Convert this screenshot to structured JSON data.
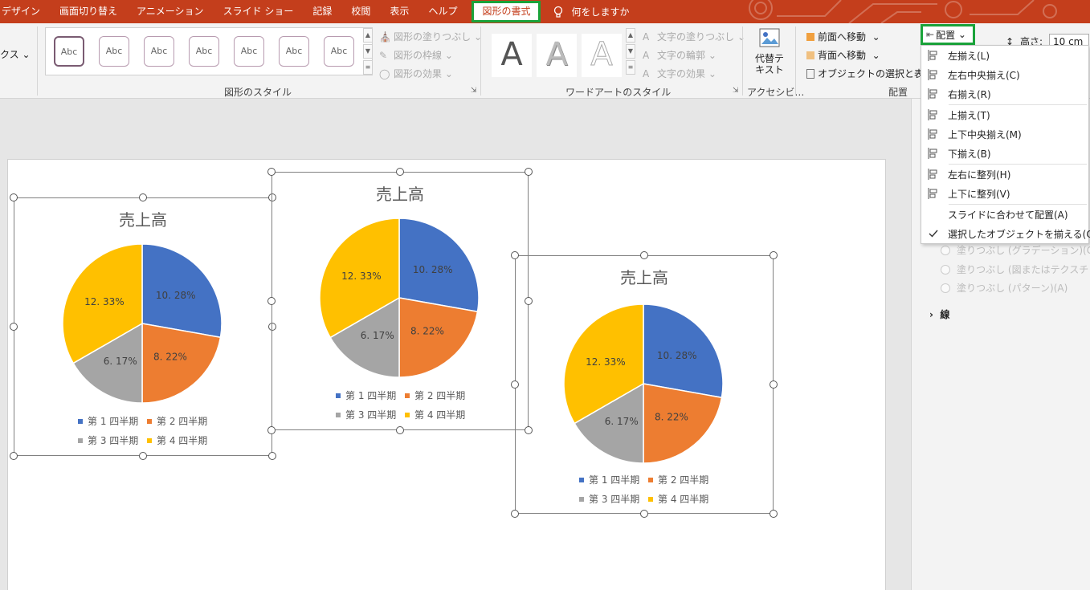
{
  "tabs": [
    "デザイン",
    "画面切り替え",
    "アニメーション",
    "スライド ショー",
    "記録",
    "校閲",
    "表示",
    "ヘルプ"
  ],
  "active_tab": "図形の書式",
  "tell_me": "何をしますか",
  "ribbon": {
    "left_cut": "クス",
    "shape_styles": {
      "abc_label": "Abc",
      "fill": "図形の塗りつぶし",
      "outline": "図形の枠線",
      "effects": "図形の効果",
      "group_label": "図形のスタイル"
    },
    "wordart": {
      "letter": "A",
      "text_fill": "文字の塗りつぶし",
      "text_outline": "文字の輪郭",
      "text_effects": "文字の効果",
      "group_label": "ワードアートのスタイル"
    },
    "alt_text": "代替テキスト",
    "alt_text_line1": "代替テ",
    "alt_text_line2": "キスト",
    "accessibility_label": "アクセシビ…",
    "arrange": {
      "bring_forward": "前面へ移動",
      "send_backward": "背面へ移動",
      "selection_pane": "オブジェクトの選択と表示",
      "group_label": "配置"
    },
    "align_button": "配置",
    "height_label": "高さ:",
    "height_value": "10 cm"
  },
  "align_menu": [
    {
      "label": "左揃え(L)",
      "sep_before": false
    },
    {
      "label": "左右中央揃え(C)",
      "sep_before": false
    },
    {
      "label": "右揃え(R)",
      "sep_before": false
    },
    {
      "label": "上揃え(T)",
      "sep_before": true
    },
    {
      "label": "上下中央揃え(M)",
      "sep_before": false
    },
    {
      "label": "下揃え(B)",
      "sep_before": false
    },
    {
      "label": "左右に整列(H)",
      "sep_before": true
    },
    {
      "label": "上下に整列(V)",
      "sep_before": false
    },
    {
      "label": "スライドに合わせて配置(A)",
      "sep_before": true
    },
    {
      "label": "選択したオブジェクトを揃える(O)",
      "sep_before": false,
      "checked": true
    }
  ],
  "right_pane": {
    "fill_gradient": "塗りつぶし (グラデーション)(G)",
    "fill_picture": "塗りつぶし (図またはテクスチャ)(P)",
    "fill_pattern": "塗りつぶし (パターン)(A)",
    "line_section": "線"
  },
  "colors": {
    "tab_bar": "#c43e1c",
    "highlight": "#1aa33a",
    "q1": "#4472c4",
    "q2": "#ed7d31",
    "q3": "#a5a5a5",
    "q4": "#ffc000"
  },
  "chart_data": [
    {
      "type": "pie",
      "title": "売上高",
      "categories": [
        "第 1 四半期",
        "第 2 四半期",
        "第 3 四半期",
        "第 4 四半期"
      ],
      "values": [
        10.28,
        8.22,
        6.17,
        12.33
      ],
      "data_labels": [
        "10. 28%",
        "8. 22%",
        "6. 17%",
        "12. 33%"
      ],
      "legend": "bottom"
    },
    {
      "type": "pie",
      "title": "売上高",
      "categories": [
        "第 1 四半期",
        "第 2 四半期",
        "第 3 四半期",
        "第 4 四半期"
      ],
      "values": [
        10.28,
        8.22,
        6.17,
        12.33
      ],
      "data_labels": [
        "10. 28%",
        "8. 22%",
        "6. 17%",
        "12. 33%"
      ],
      "legend": "bottom"
    },
    {
      "type": "pie",
      "title": "売上高",
      "categories": [
        "第 1 四半期",
        "第 2 四半期",
        "第 3 四半期",
        "第 4 四半期"
      ],
      "values": [
        10.28,
        8.22,
        6.17,
        12.33
      ],
      "data_labels": [
        "10. 28%",
        "8. 22%",
        "6. 17%",
        "12. 33%"
      ],
      "legend": "bottom"
    }
  ]
}
